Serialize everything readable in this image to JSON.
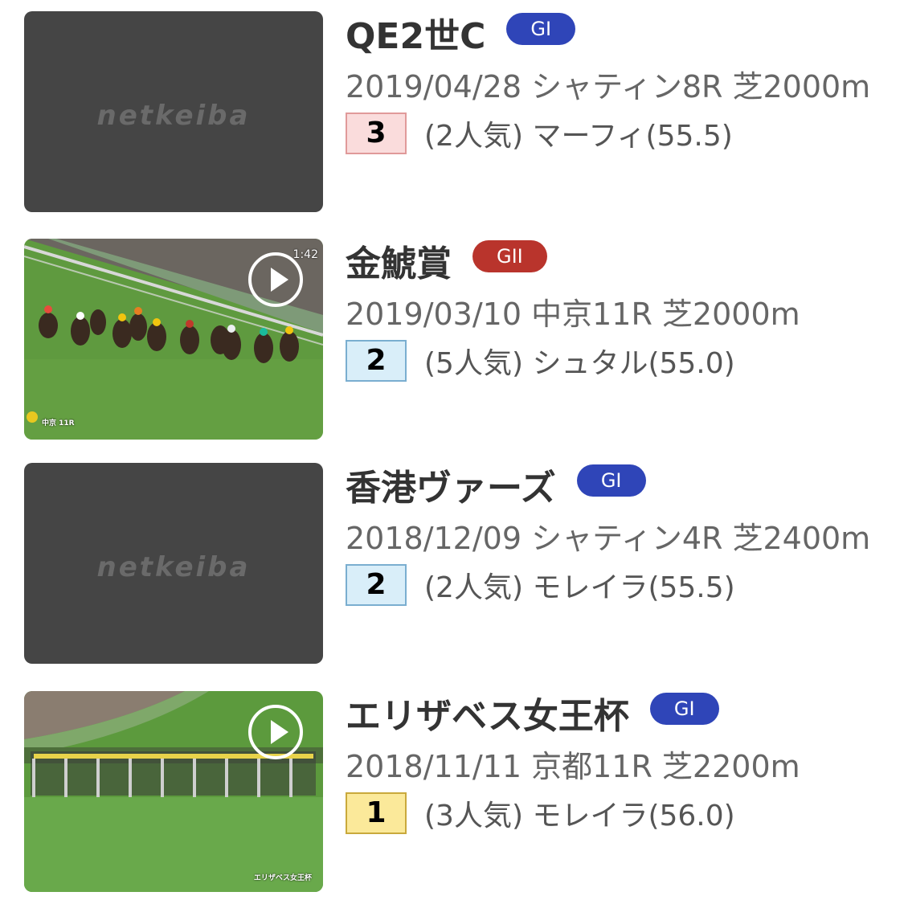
{
  "colors": {
    "grade_g1": "#2f45b8",
    "grade_g2": "#b9342c",
    "rank_1_bg": "#fbe99a",
    "rank_1_border": "#c9a93c",
    "rank_2_bg": "#d9eef9",
    "rank_2_border": "#7aaed0",
    "rank_3_bg": "#fadcdc",
    "rank_3_border": "#e09a9a"
  },
  "races": [
    {
      "title": "QE2世C",
      "grade": "GI",
      "meta": "2019/04/28 シャティン8R 芝2000m",
      "rank": "3",
      "result": "(2人気) マーフィ(55.5)",
      "thumbnail": {
        "type": "placeholder",
        "logo": "netkeiba"
      }
    },
    {
      "title": "金鯱賞",
      "grade": "GII",
      "meta": "2019/03/10 中京11R 芝2000m",
      "rank": "2",
      "result": "(5人気) シュタル(55.0)",
      "thumbnail": {
        "type": "video",
        "duration": "1:42",
        "overlay_label": "中京 11R",
        "icon": "play-icon"
      }
    },
    {
      "title": "香港ヴァーズ",
      "grade": "GI",
      "meta": "2018/12/09 シャティン4R 芝2400m",
      "rank": "2",
      "result": "(2人気) モレイラ(55.5)",
      "thumbnail": {
        "type": "placeholder",
        "logo": "netkeiba"
      }
    },
    {
      "title": "エリザベス女王杯",
      "grade": "GI",
      "meta": "2018/11/11 京都11R 芝2200m",
      "rank": "1",
      "result": "(3人気) モレイラ(56.0)",
      "thumbnail": {
        "type": "video",
        "overlay_label": "エリザベス女王杯",
        "icon": "play-icon"
      }
    }
  ]
}
